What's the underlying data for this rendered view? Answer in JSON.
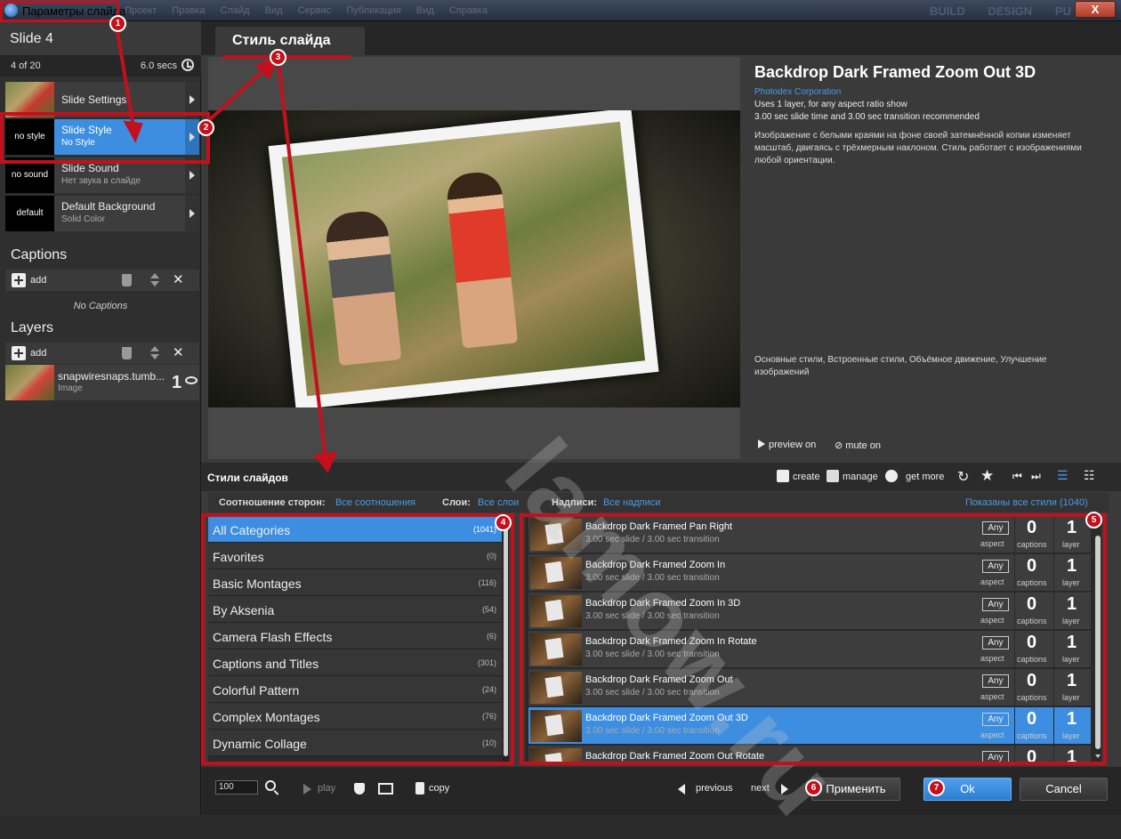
{
  "window": {
    "title": "Параметры слайда",
    "menu": [
      "Проект",
      "Правка",
      "Слайд",
      "Вид",
      "Сервис",
      "Публикация",
      "Вид",
      "Справка"
    ],
    "modes": [
      "BUILD",
      "DESIGN",
      "PU"
    ],
    "close_label": "X"
  },
  "left": {
    "slide_name": "Slide 4",
    "slide_count": "4 of 20",
    "slide_secs": "6.0 secs",
    "options": [
      {
        "title": "Slide Settings",
        "subtitle": "",
        "thumb": ""
      },
      {
        "title": "Slide Style",
        "subtitle": "No Style",
        "thumb": "no style"
      },
      {
        "title": "Slide Sound",
        "subtitle": "Нет звука в слайде",
        "thumb": "no sound"
      },
      {
        "title": "Default Background",
        "subtitle": "Solid Color",
        "thumb": "default"
      }
    ],
    "captions_title": "Captions",
    "add_label": "add",
    "no_captions": "No Captions",
    "layers_title": "Layers",
    "layer": {
      "name": "snapwiresnaps.tumb...",
      "type": "Image",
      "number": "1"
    }
  },
  "main": {
    "tab_label": "Стиль слайда",
    "style": {
      "title": "Backdrop Dark Framed Zoom Out 3D",
      "author": "Photodex Corporation",
      "line1": "Uses 1 layer, for any aspect ratio show",
      "line2": "3.00 sec slide time and 3.00 sec transition recommended",
      "description": "Изображение с белыми краями на фоне своей затемнённой копии изменяет масштаб, двигаясь с трёхмерным наклоном. Стиль работает с изображениями любой ориентации.",
      "categories": "Основные стили, Встроенные стили, Объёмное движение, Улучшение изображений"
    },
    "preview_on": "preview on",
    "mute_on": "mute on",
    "styles_label": "Стили слайдов",
    "tools": {
      "create": "create",
      "manage": "manage",
      "get_more": "get more"
    },
    "filters": {
      "aspect_key": "Соотношение сторон:",
      "aspect_val": "Все соотношения",
      "layers_key": "Слои:",
      "layers_val": "Все слои",
      "captions_key": "Надписи:",
      "captions_val": "Все надписи",
      "shown": "Показаны все стили (1040)"
    },
    "categories": [
      {
        "name": "All Categories",
        "count": "(1041)"
      },
      {
        "name": "Favorites",
        "count": "(0)"
      },
      {
        "name": "Basic Montages",
        "count": "(116)"
      },
      {
        "name": "By Aksenia",
        "count": "(54)"
      },
      {
        "name": "Camera Flash Effects",
        "count": "(6)"
      },
      {
        "name": "Captions and Titles",
        "count": "(301)"
      },
      {
        "name": "Colorful Pattern",
        "count": "(24)"
      },
      {
        "name": "Complex Montages",
        "count": "(76)"
      },
      {
        "name": "Dynamic Collage",
        "count": "(10)"
      }
    ],
    "styles": [
      {
        "name": "Backdrop Dark Framed Pan Right",
        "timing": "3.00 sec slide / 3.00 sec transition"
      },
      {
        "name": "Backdrop Dark Framed Zoom In",
        "timing": "3.00 sec slide / 3.00 sec transition"
      },
      {
        "name": "Backdrop Dark Framed Zoom In 3D",
        "timing": "3.00 sec slide / 3.00 sec transition"
      },
      {
        "name": "Backdrop Dark Framed Zoom In Rotate",
        "timing": "3.00 sec slide / 3.00 sec transition"
      },
      {
        "name": "Backdrop Dark Framed Zoom Out",
        "timing": "3.00 sec slide / 3.00 sec transition"
      },
      {
        "name": "Backdrop Dark Framed Zoom Out 3D",
        "timing": "3.00 sec slide / 3.00 sec transition"
      },
      {
        "name": "Backdrop Dark Framed Zoom Out Rotate",
        "timing": ""
      }
    ],
    "row_labels": {
      "any": "Any",
      "aspect": "aspect",
      "captions_num": "0",
      "captions": "captions",
      "layer_num": "1",
      "layer": "layer"
    }
  },
  "footer": {
    "zoom": "100",
    "play": "play",
    "copy": "copy",
    "previous": "previous",
    "next": "next",
    "apply": "Применить",
    "ok": "Ok",
    "cancel": "Cancel"
  },
  "annotations": {
    "badges": [
      "1",
      "2",
      "3",
      "4",
      "5",
      "6",
      "7"
    ],
    "watermark": "lamow.ru",
    "color": "#c2111c"
  },
  "colors": {
    "accent": "#3d8ee0",
    "link": "#4a9be8"
  }
}
